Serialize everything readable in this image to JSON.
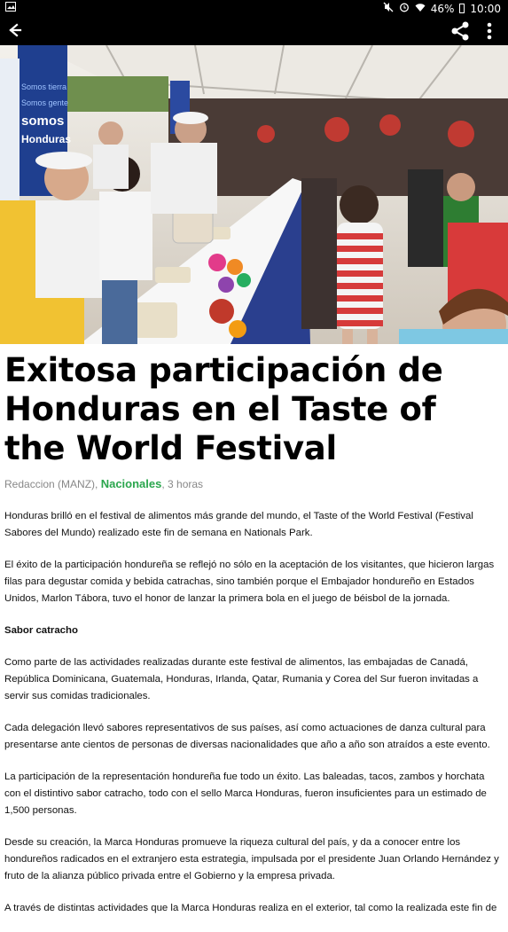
{
  "status_bar": {
    "battery": "46%",
    "time": "10:00"
  },
  "article": {
    "title": "Exitosa participación de Honduras en el Taste of the World Festival",
    "author": "Redaccion (MANZ)",
    "section": "Nacionales",
    "time_ago": "3 horas",
    "paragraphs": [
      "Honduras brilló en el festival de alimentos más grande del mundo, el Taste of the World Festival (Festival Sabores del Mundo) realizado este fin de semana en Nationals Park.",
      "El éxito de la participación hondureña se reflejó no sólo en la aceptación de los visitantes, que hicieron largas filas para degustar comida y bebida catrachas, sino también porque el Embajador hondureño en Estados Unidos, Marlon Tábora, tuvo el honor de lanzar la primera bola en el juego de béisbol de la jornada.",
      "Sabor catracho",
      "Como parte de las actividades realizadas durante este festival de alimentos, las embajadas de Canadá, República Dominicana, Guatemala, Honduras, Irlanda, Qatar, Rumania y Corea del Sur fueron invitadas a servir sus comidas tradicionales.",
      "Cada delegación llevó sabores representativos de sus países, así como actuaciones de danza cultural para presentarse ante cientos de personas de diversas nacionalidades que año a año son atraídos a este evento.",
      "La participación de la representación hondureña fue todo un éxito. Las baleadas, tacos, zambos y horchata con el distintivo sabor catracho, todo con el sello Marca Honduras, fueron insuficientes para un estimado de 1,500 personas.",
      "Desde su creación, la Marca Honduras promueve la riqueza cultural del país, y da a conocer entre los hondureños radicados en el extranjero esta estrategia, impulsada por el presidente Juan Orlando Hernández y fruto de la alianza público privada entre el Gobierno y la empresa privada.",
      "A través de distintas actividades que la Marca Honduras realiza en el exterior, tal como la realizada este fin de"
    ]
  },
  "hero_image": {
    "banner_text": "Somos tierra Somos gente somos Honduras"
  }
}
